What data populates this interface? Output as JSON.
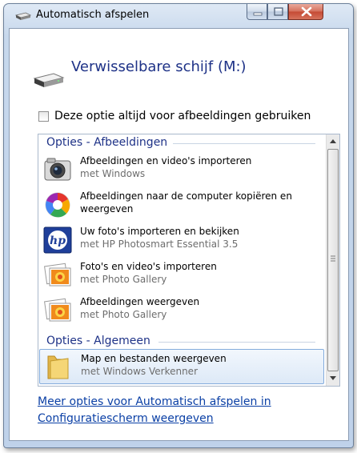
{
  "window": {
    "title": "Automatisch afspelen",
    "controls": {
      "minimize": "minimize",
      "maximize": "maximize",
      "close": "close"
    }
  },
  "drive": {
    "title": "Verwisselbare schijf (M:)",
    "icon": "removable-drive-icon"
  },
  "always_option": {
    "label": "Deze optie altijd voor afbeeldingen gebruiken",
    "checked": false
  },
  "groups": [
    {
      "header": "Opties - Afbeeldingen",
      "items": [
        {
          "title": "Afbeeldingen en video's importeren",
          "sub": "met Windows",
          "icon": "camera-icon"
        },
        {
          "title": "Afbeeldingen naar de computer kopiëren en",
          "sub": "weergeven",
          "icon": "picasa-icon"
        },
        {
          "title": "Uw foto's importeren en bekijken",
          "sub": "met HP Photosmart Essential 3.5",
          "icon": "hp-icon"
        },
        {
          "title": "Foto's en video's importeren",
          "sub": "met Photo Gallery",
          "icon": "photo-gallery-icon"
        },
        {
          "title": "Afbeeldingen weergeven",
          "sub": "met Photo Gallery",
          "icon": "photo-gallery-icon"
        }
      ]
    },
    {
      "header": "Opties - Algemeen",
      "items": [
        {
          "title": "Map en bestanden weergeven",
          "sub": "met Windows Verkenner",
          "icon": "folder-icon",
          "selected": true
        }
      ]
    }
  ],
  "footer_link": {
    "line1": "Meer opties voor Automatisch afspelen in",
    "line2": "Configuratiescherm weergeven"
  }
}
